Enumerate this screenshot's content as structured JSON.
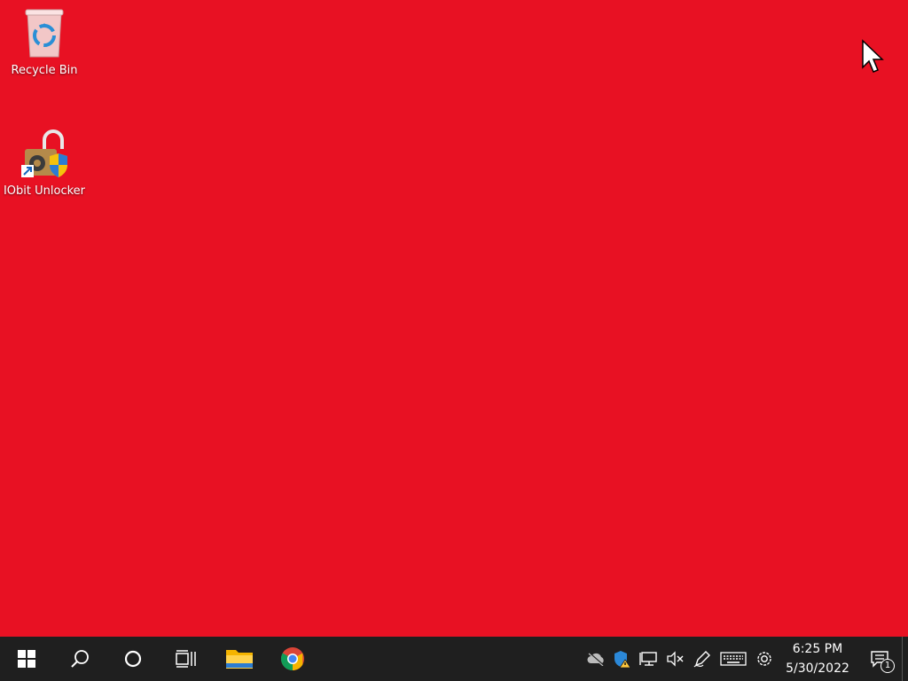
{
  "desktop": {
    "background_color": "#e81123",
    "icons": [
      {
        "label": "Recycle Bin",
        "icon": "recycle-bin-icon"
      },
      {
        "label": "IObit Unlocker",
        "icon": "iobit-unlocker-icon"
      }
    ]
  },
  "taskbar": {
    "background_color": "#1f1f1f",
    "buttons": [
      {
        "icon": "windows-start-icon"
      },
      {
        "icon": "search-icon"
      },
      {
        "icon": "cortana-icon"
      },
      {
        "icon": "task-view-icon"
      },
      {
        "icon": "file-explorer-icon"
      },
      {
        "icon": "chrome-icon"
      }
    ],
    "tray": {
      "icons": [
        "onedrive-offline-icon",
        "security-warning-icon",
        "network-icon",
        "volume-muted-icon",
        "pen-icon",
        "touch-keyboard-icon",
        "settings-icon"
      ],
      "time": "6:25 PM",
      "date": "5/30/2022",
      "notification_count": "1"
    }
  }
}
